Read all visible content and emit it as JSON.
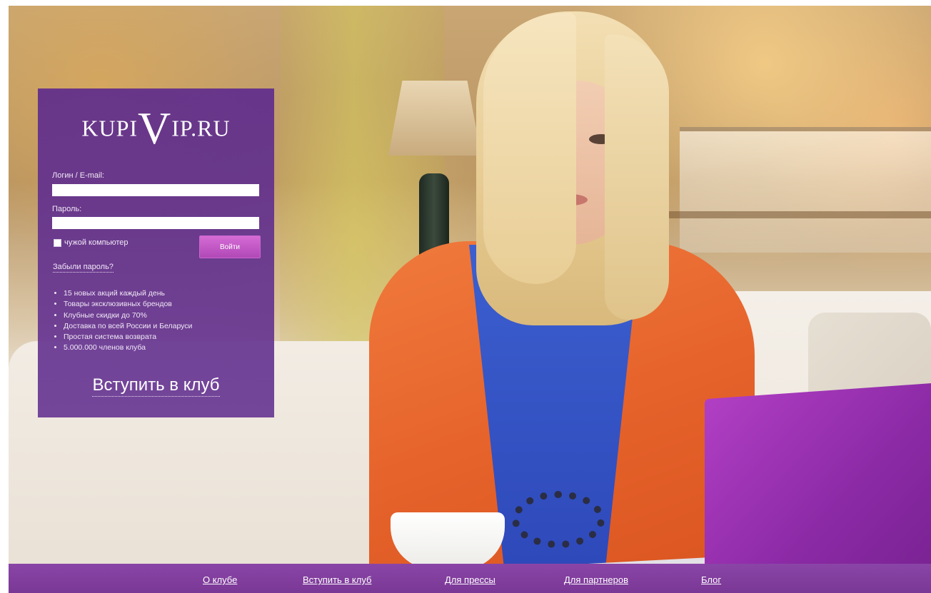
{
  "logo": {
    "left": "KUPI",
    "v": "V",
    "right": "IP.RU"
  },
  "login": {
    "login_label": "Логин / E-mail:",
    "login_value": "",
    "password_label": "Пароль:",
    "password_value": "",
    "foreign_computer_label": "чужой компьютер",
    "foreign_computer_checked": false,
    "submit_label": "Войти",
    "forgot_link": "Забыли пароль?"
  },
  "benefits": [
    "15 новых акций каждый день",
    "Товары эксклюзивных брендов",
    "Клубные скидки до 70%",
    "Доставка по всей России и Беларуси",
    "Простая система возврата",
    "5.000.000 членов клуба"
  ],
  "join_link": "Вступить в клуб",
  "footer": {
    "links": [
      "О клубе",
      "Вступить в клуб",
      "Для прессы",
      "Для партнеров",
      "Блог"
    ]
  },
  "colors": {
    "panel_purple": "#602e8c",
    "footer_purple": "#82409e",
    "button_pink": "#c25bc6"
  }
}
